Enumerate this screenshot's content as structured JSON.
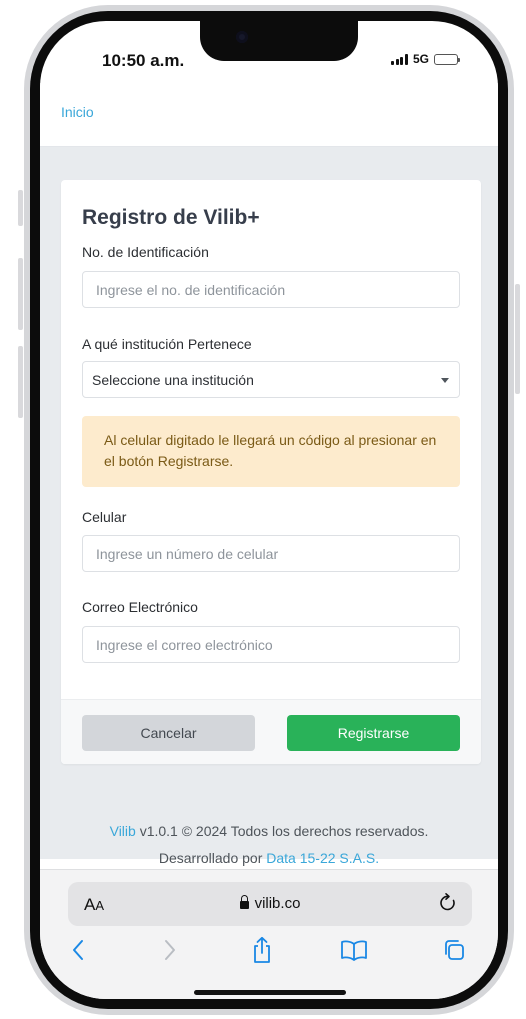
{
  "status_bar": {
    "time": "10:50 a.m.",
    "network": "5G",
    "signal_level": 3,
    "battery_level": 1.0
  },
  "nav": {
    "home_link": "Inicio"
  },
  "form": {
    "title": "Registro de Vilib+",
    "id_label": "No. de Identificación",
    "id_placeholder": "Ingrese el no. de identificación",
    "institution_label": "A qué institución Pertenece",
    "institution_selected": "Seleccione una institución",
    "alert_text": "Al celular digitado le llegará un código al presionar en el botón Registrarse.",
    "phone_label": "Celular",
    "phone_placeholder": "Ingrese un número de celular",
    "email_label": "Correo Electrónico",
    "email_placeholder": "Ingrese el correo electrónico",
    "cancel_label": "Cancelar",
    "submit_label": "Registrarse"
  },
  "footer": {
    "brand": "Vilib",
    "copyright": " v1.0.1 © 2024 Todos los derechos reservados.",
    "developed_by": "Desarrollado por ",
    "developer": "Data 15-22 S.A.S."
  },
  "browser": {
    "aa_label_big": "A",
    "aa_label_small": "A",
    "url": "vilib.co"
  },
  "colors": {
    "link": "#3aa7d9",
    "submit": "#29b259",
    "alert_bg": "#fdebcd",
    "alert_text": "#7a5a16"
  },
  "icons": {
    "reload": "reload-icon",
    "back": "chevron-left-icon",
    "forward": "chevron-right-icon",
    "share": "share-icon",
    "bookmarks": "book-icon",
    "tabs": "tabs-icon"
  }
}
